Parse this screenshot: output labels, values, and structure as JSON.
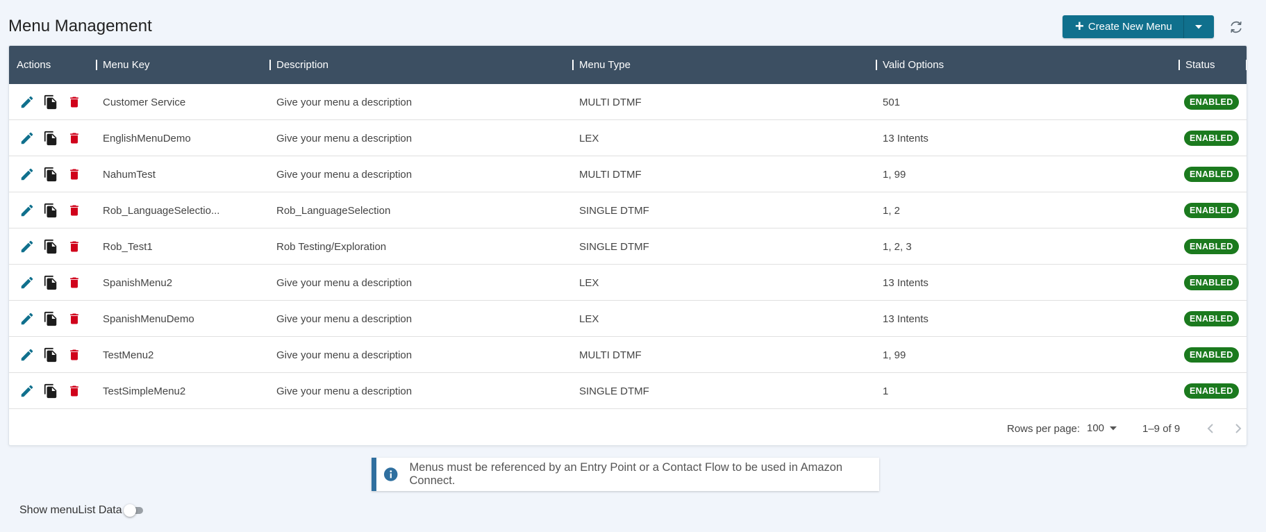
{
  "page": {
    "title": "Menu Management"
  },
  "toolbar": {
    "create_label": "Create New Menu"
  },
  "table": {
    "headers": {
      "actions": "Actions",
      "menu_key": "Menu Key",
      "description": "Description",
      "menu_type": "Menu Type",
      "valid_options": "Valid Options",
      "status": "Status"
    },
    "rows": [
      {
        "menu_key": "Customer Service",
        "description": "Give your menu a description",
        "menu_type": "MULTI DTMF",
        "valid_options": "501",
        "status": "ENABLED"
      },
      {
        "menu_key": "EnglishMenuDemo",
        "description": "Give your menu a description",
        "menu_type": "LEX",
        "valid_options": "13 Intents",
        "status": "ENABLED"
      },
      {
        "menu_key": "NahumTest",
        "description": "Give your menu a description",
        "menu_type": "MULTI DTMF",
        "valid_options": "1, 99",
        "status": "ENABLED"
      },
      {
        "menu_key": "Rob_LanguageSelectio...",
        "description": "Rob_LanguageSelection",
        "menu_type": "SINGLE DTMF",
        "valid_options": "1, 2",
        "status": "ENABLED"
      },
      {
        "menu_key": "Rob_Test1",
        "description": "Rob Testing/Exploration",
        "menu_type": "SINGLE DTMF",
        "valid_options": "1, 2, 3",
        "status": "ENABLED"
      },
      {
        "menu_key": "SpanishMenu2",
        "description": "Give your menu a description",
        "menu_type": "LEX",
        "valid_options": "13 Intents",
        "status": "ENABLED"
      },
      {
        "menu_key": "SpanishMenuDemo",
        "description": "Give your menu a description",
        "menu_type": "LEX",
        "valid_options": "13 Intents",
        "status": "ENABLED"
      },
      {
        "menu_key": "TestMenu2",
        "description": "Give your menu a description",
        "menu_type": "MULTI DTMF",
        "valid_options": "1, 99",
        "status": "ENABLED"
      },
      {
        "menu_key": "TestSimpleMenu2",
        "description": "Give your menu a description",
        "menu_type": "SINGLE DTMF",
        "valid_options": "1",
        "status": "ENABLED"
      }
    ]
  },
  "pagination": {
    "rows_per_page_label": "Rows per page:",
    "rows_per_page_value": "100",
    "range": "1–9 of 9"
  },
  "info_banner": {
    "text": "Menus must be referenced by an Entry Point or a Contact Flow to be used in Amazon Connect."
  },
  "toggle": {
    "label": "Show menuList Data",
    "checked": false
  },
  "icons": {
    "edit": "pencil-icon",
    "copy": "copy-icon",
    "delete": "trash-icon",
    "refresh": "refresh-icon",
    "info": "info-icon",
    "dropdown": "caret-down-icon",
    "prev": "chevron-left-icon",
    "next": "chevron-right-icon"
  },
  "colors": {
    "primary": "#10708d",
    "header_bg": "#3c4f62",
    "status_enabled": "#1b7a1e",
    "delete": "#d0021b",
    "edit": "#10708d"
  }
}
